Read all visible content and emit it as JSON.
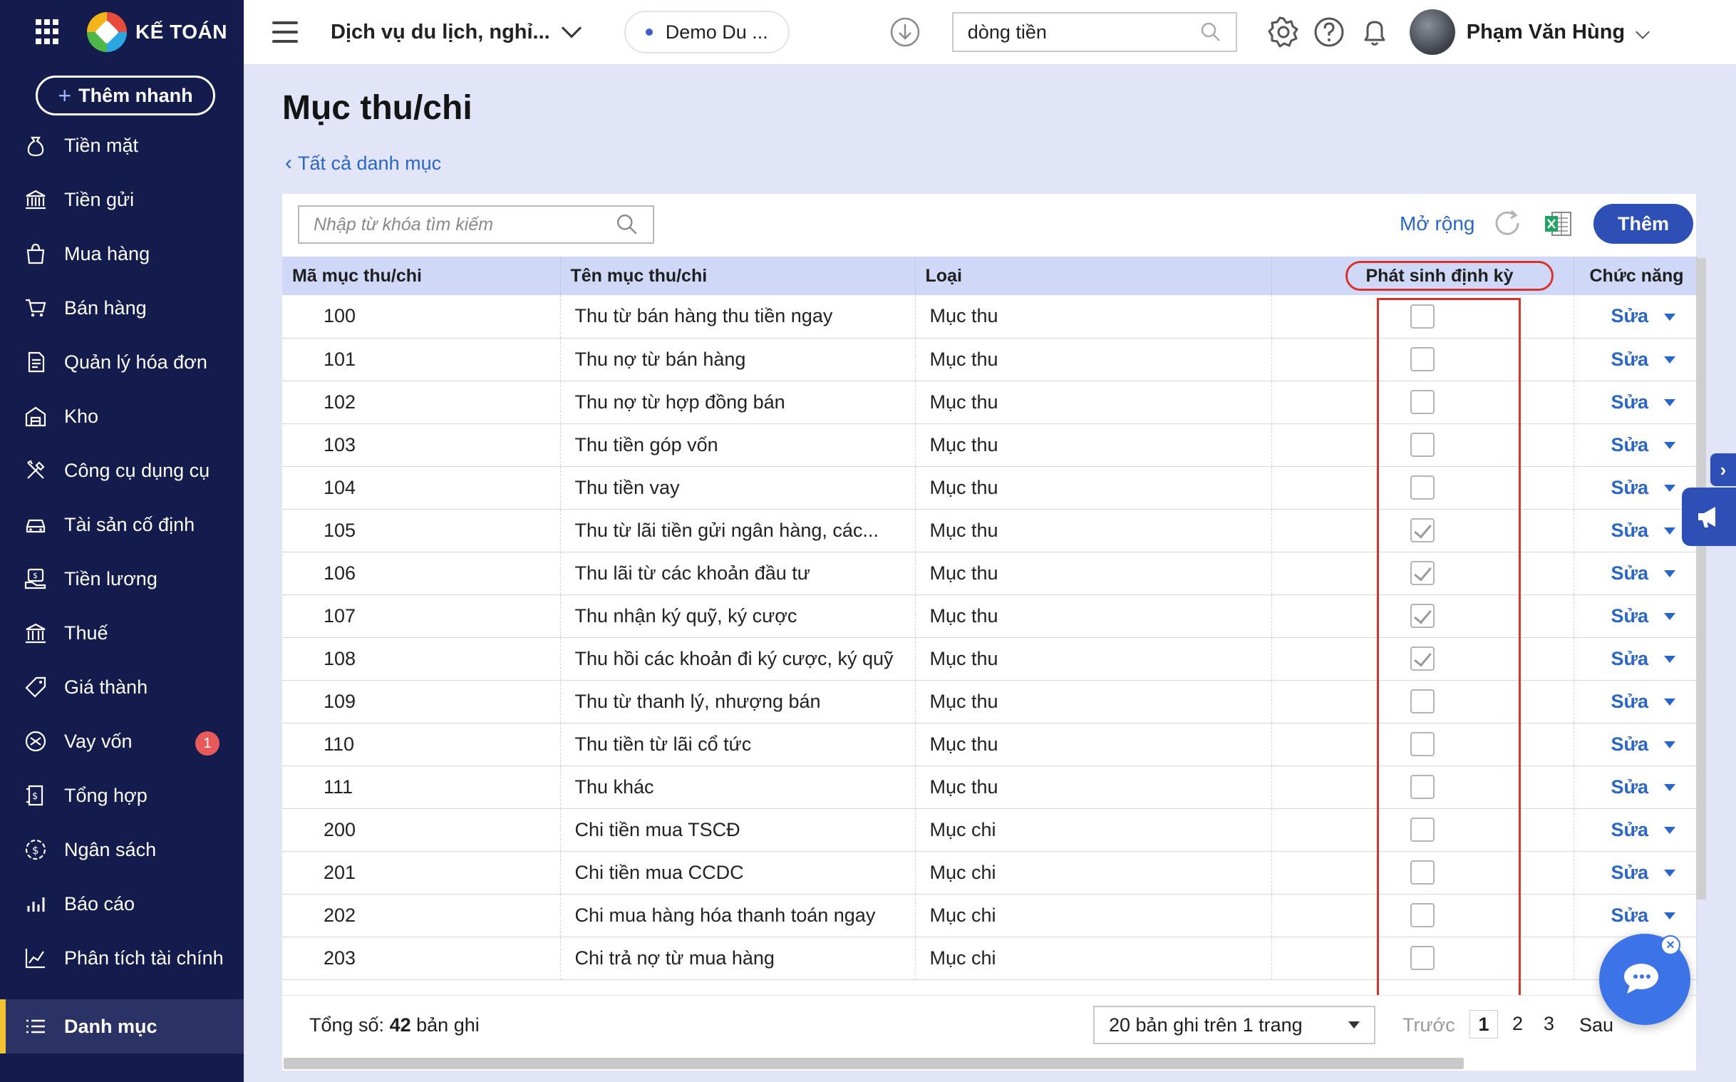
{
  "app": {
    "logo_text": "KẾ TOÁN",
    "quick_add_label": "Thêm nhanh"
  },
  "sidebar": {
    "items": [
      {
        "label": "Tiền mặt",
        "icon": "money-bag-icon"
      },
      {
        "label": "Tiền gửi",
        "icon": "bank-icon"
      },
      {
        "label": "Mua hàng",
        "icon": "shopping-bag-icon"
      },
      {
        "label": "Bán hàng",
        "icon": "cart-icon"
      },
      {
        "label": "Quản lý hóa đơn",
        "icon": "invoice-icon"
      },
      {
        "label": "Kho",
        "icon": "warehouse-icon"
      },
      {
        "label": "Công cụ dụng cụ",
        "icon": "tools-icon"
      },
      {
        "label": "Tài sản cố định",
        "icon": "car-icon"
      },
      {
        "label": "Tiền lương",
        "icon": "salary-icon"
      },
      {
        "label": "Thuế",
        "icon": "tax-building-icon"
      },
      {
        "label": "Giá thành",
        "icon": "price-tag-icon"
      },
      {
        "label": "Vay vốn",
        "icon": "loan-icon",
        "badge": "1"
      },
      {
        "label": "Tổng hợp",
        "icon": "summary-icon"
      },
      {
        "label": "Ngân sách",
        "icon": "budget-icon"
      },
      {
        "label": "Báo cáo",
        "icon": "report-chart-icon"
      },
      {
        "label": "Phân tích tài chính",
        "icon": "analysis-icon"
      }
    ],
    "active_item": {
      "label": "Danh mục",
      "icon": "list-icon"
    }
  },
  "topbar": {
    "company": "Dịch vụ du lịch, nghỉ...",
    "demo": "Demo Du ...",
    "search_value": "dòng tiền",
    "user_name": "Phạm Văn Hùng"
  },
  "page": {
    "title": "Mục thu/chi",
    "breadcrumb": "Tất cả danh mục",
    "search_placeholder": "Nhập từ khóa tìm kiếm",
    "expand_label": "Mở rộng",
    "add_label": "Thêm"
  },
  "table": {
    "headers": {
      "code": "Mã mục thu/chi",
      "name": "Tên mục thu/chi",
      "type": "Loại",
      "recurring": "Phát sinh định kỳ",
      "action": "Chức năng"
    },
    "edit_label": "Sửa",
    "rows": [
      {
        "code": "100",
        "name": "Thu từ bán hàng thu tiền ngay",
        "type": "Mục thu",
        "recurring": false
      },
      {
        "code": "101",
        "name": "Thu nợ từ bán hàng",
        "type": "Mục thu",
        "recurring": false
      },
      {
        "code": "102",
        "name": "Thu nợ từ hợp đồng bán",
        "type": "Mục thu",
        "recurring": false
      },
      {
        "code": "103",
        "name": "Thu tiền góp vốn",
        "type": "Mục thu",
        "recurring": false
      },
      {
        "code": "104",
        "name": "Thu tiền vay",
        "type": "Mục thu",
        "recurring": false
      },
      {
        "code": "105",
        "name": "Thu từ lãi tiền gửi ngân hàng, các...",
        "type": "Mục thu",
        "recurring": true
      },
      {
        "code": "106",
        "name": "Thu lãi từ các khoản đầu tư",
        "type": "Mục thu",
        "recurring": true
      },
      {
        "code": "107",
        "name": "Thu nhận ký quỹ, ký cược",
        "type": "Mục thu",
        "recurring": true
      },
      {
        "code": "108",
        "name": "Thu hồi các khoản đi ký cược, ký quỹ",
        "type": "Mục thu",
        "recurring": true
      },
      {
        "code": "109",
        "name": "Thu từ thanh lý, nhượng bán",
        "type": "Mục thu",
        "recurring": false
      },
      {
        "code": "110",
        "name": "Thu tiền từ lãi cổ tức",
        "type": "Mục thu",
        "recurring": false
      },
      {
        "code": "111",
        "name": "Thu khác",
        "type": "Mục thu",
        "recurring": false
      },
      {
        "code": "200",
        "name": "Chi tiền mua TSCĐ",
        "type": "Mục chi",
        "recurring": false
      },
      {
        "code": "201",
        "name": "Chi tiền mua CCDC",
        "type": "Mục chi",
        "recurring": false
      },
      {
        "code": "202",
        "name": "Chi mua hàng hóa thanh toán ngay",
        "type": "Mục chi",
        "recurring": false
      },
      {
        "code": "203",
        "name": "Chi trả nợ từ mua hàng",
        "type": "Mục chi",
        "recurring": false
      }
    ]
  },
  "footer": {
    "total_label": "Tổng số:",
    "total_count": "42",
    "total_suffix": "bản ghi",
    "page_size": "20 bản ghi trên 1 trang",
    "prev": "Trước",
    "pages": [
      "1",
      "2",
      "3"
    ],
    "next": "Sau"
  },
  "colors": {
    "sidebar": "#141b4d",
    "accent": "#2e4fb6",
    "highlight": "#d9342b",
    "header_row": "#cfd8f6"
  }
}
